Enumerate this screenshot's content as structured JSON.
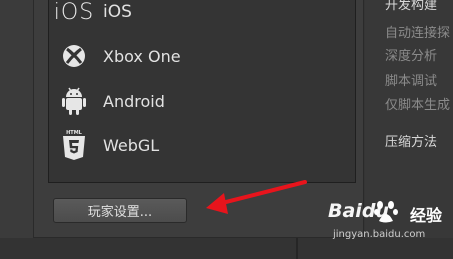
{
  "platforms": [
    {
      "label": "iOS",
      "icon": "ios-icon"
    },
    {
      "label": "Xbox One",
      "icon": "xbox-icon"
    },
    {
      "label": "Android",
      "icon": "android-icon"
    },
    {
      "label": "WebGL",
      "icon": "html5-icon"
    }
  ],
  "ios_logo_text": "iOS",
  "html5_badge_text": "HTML",
  "player_settings_label": "玩家设置...",
  "right_menu": [
    {
      "label": "开发构建"
    },
    {
      "label": "自动连接探"
    },
    {
      "label": "深度分析"
    },
    {
      "label": "脚本调试"
    },
    {
      "label": "仅脚本生成"
    },
    {
      "label": "压缩方法"
    }
  ],
  "annotation": {
    "arrow_color": "#e8141c"
  },
  "watermark": {
    "brand": "Baidu",
    "product": "经验",
    "url": "jingyan.baidu.com"
  }
}
